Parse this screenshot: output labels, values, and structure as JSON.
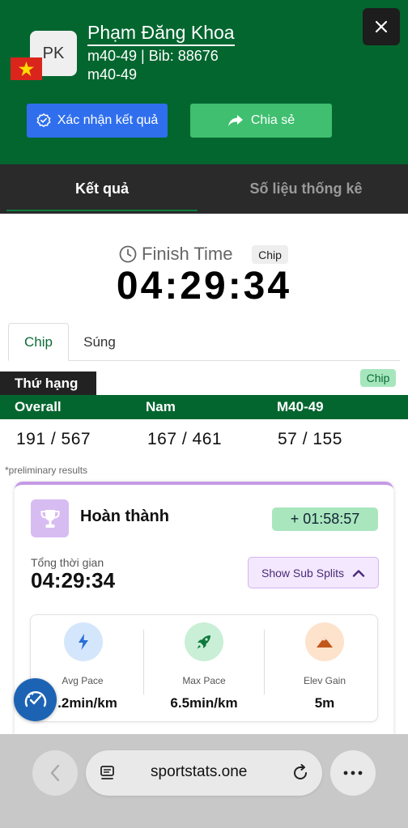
{
  "header": {
    "avatar_initials": "PK",
    "flag": "vietnam-flag",
    "athlete_name": "Phạm Đăng Khoa",
    "category_bib": "m40-49 | Bib: 88676",
    "category": "m40-49",
    "confirm_label": "Xác nhận kết quả",
    "share_label": "Chia sẻ",
    "colors": {
      "background": "#03662f",
      "confirm": "#2f6fee",
      "share": "#3fbf6f"
    }
  },
  "tabs": [
    {
      "label": "Kết quả",
      "active": true
    },
    {
      "label": "Số liệu thống kê",
      "active": false
    }
  ],
  "finish": {
    "label": "Finish Time",
    "chip_badge": "Chip",
    "time": "04:29:34"
  },
  "subtabs": [
    {
      "label": "Chip",
      "active": true
    },
    {
      "label": "Súng",
      "active": false
    }
  ],
  "ranking": {
    "title": "Thứ hạng",
    "badge": "Chip",
    "columns": [
      "Overall",
      "Nam",
      "M40-49"
    ],
    "values": [
      "191 / 567",
      "167 / 461",
      "57 / 155"
    ],
    "note": "*preliminary results"
  },
  "card": {
    "title": "Hoàn thành",
    "delta": "+ 01:58:57",
    "total_label": "Tổng thời gian",
    "total_value": "04:29:34",
    "subsplits_label": "Show Sub Splits",
    "stats": [
      {
        "icon": "lightning-icon",
        "label": "Avg Pace",
        "value": ".2min/km"
      },
      {
        "icon": "rocket-icon",
        "label": "Max Pace",
        "value": "6.5min/km"
      },
      {
        "icon": "mountain-icon",
        "label": "Elev Gain",
        "value": "5m"
      }
    ]
  },
  "browser": {
    "url": "sportstats.one"
  }
}
